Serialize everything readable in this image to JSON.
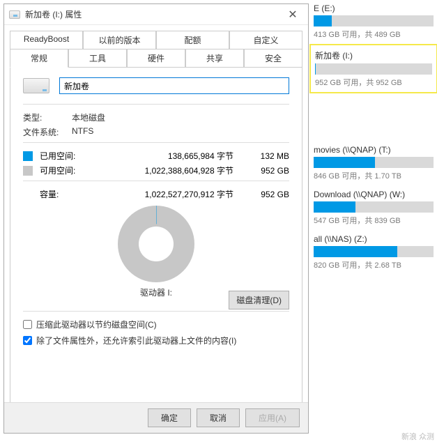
{
  "dialog": {
    "title": "新加卷 (I:) 属性",
    "tabs_row1": [
      "ReadyBoost",
      "以前的版本",
      "配额",
      "自定义"
    ],
    "tabs_row2": [
      "常规",
      "工具",
      "硬件",
      "共享",
      "安全"
    ],
    "active_tab": "常规",
    "volume_name": "新加卷",
    "type_label": "类型:",
    "type_value": "本地磁盘",
    "fs_label": "文件系统:",
    "fs_value": "NTFS",
    "used_label": "已用空间:",
    "used_bytes": "138,665,984 字节",
    "used_hr": "132 MB",
    "free_label": "可用空间:",
    "free_bytes": "1,022,388,604,928 字节",
    "free_hr": "952 GB",
    "cap_label": "容量:",
    "cap_bytes": "1,022,527,270,912 字节",
    "cap_hr": "952 GB",
    "drive_letter": "驱动器 I:",
    "clean_btn": "磁盘清理(D)",
    "chk1": "压缩此驱动器以节约磁盘空间(C)",
    "chk2": "除了文件属性外，还允许索引此驱动器上文件的内容(I)",
    "btn_ok": "确定",
    "btn_cancel": "取消",
    "btn_apply": "应用(A)",
    "used_color": "#0099e5",
    "free_color": "#c7c7c7"
  },
  "drives": [
    {
      "name": "E (E:)",
      "info": "413 GB 可用，共 489 GB",
      "fill_pct": 15,
      "highlight": false
    },
    {
      "name": "新加卷 (I:)",
      "info": "952 GB 可用，共 952 GB",
      "fill_pct": 0.1,
      "highlight": true
    },
    {
      "name": "movies (\\\\QNAP) (T:)",
      "info": "846 GB 可用，共 1.70 TB",
      "fill_pct": 51,
      "highlight": false,
      "gap_before": true
    },
    {
      "name": "Download (\\\\QNAP) (W:)",
      "info": "547 GB 可用，共 839 GB",
      "fill_pct": 35,
      "highlight": false
    },
    {
      "name": "all (\\\\NAS) (Z:)",
      "info": "820 GB 可用，共 2.68 TB",
      "fill_pct": 70,
      "highlight": false
    }
  ],
  "watermark": "新浪\n众测"
}
